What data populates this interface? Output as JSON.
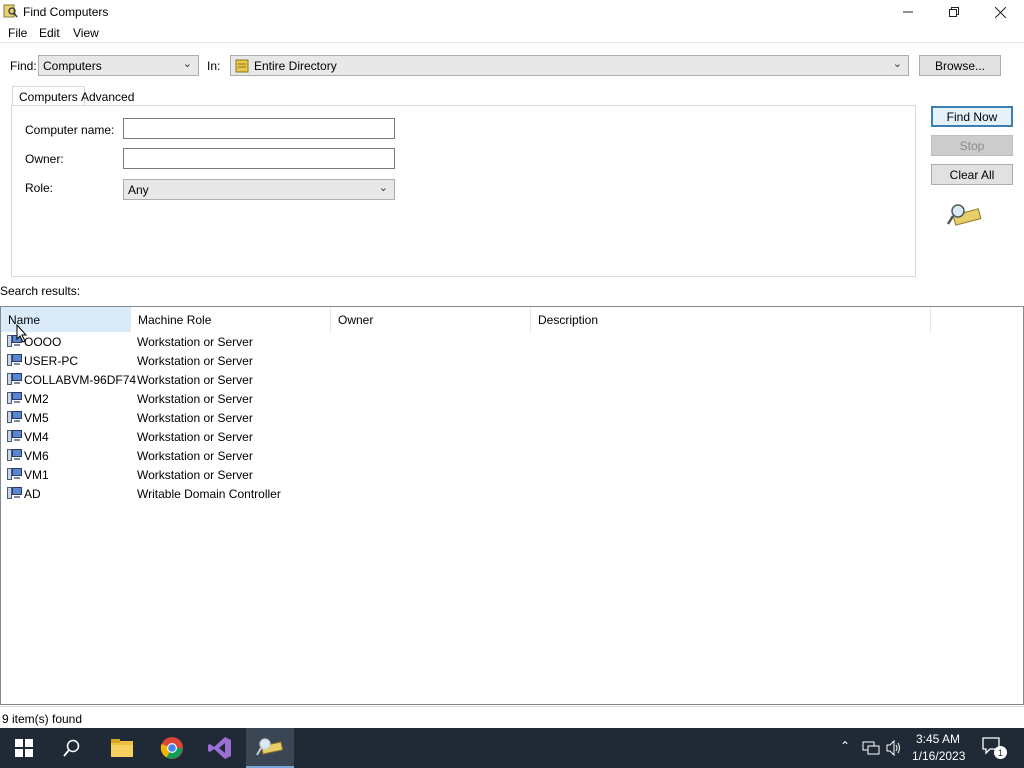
{
  "window": {
    "title": "Find Computers",
    "icon": "find-computers-icon"
  },
  "menu": [
    "File",
    "Edit",
    "View"
  ],
  "find_row": {
    "find_label": "Find:",
    "find_value": "Computers",
    "in_label": "In:",
    "in_value": "Entire Directory",
    "browse_label": "Browse..."
  },
  "tabs": [
    "Computers",
    "Advanced"
  ],
  "form": {
    "computer_name_label": "Computer name:",
    "computer_name_value": "",
    "owner_label": "Owner:",
    "owner_value": "",
    "role_label": "Role:",
    "role_value": "Any"
  },
  "actions": {
    "find_now": "Find Now",
    "stop": "Stop",
    "clear_all": "Clear All"
  },
  "results": {
    "label": "Search results:",
    "columns": [
      "Name",
      "Machine Role",
      "Owner",
      "Description"
    ],
    "rows": [
      {
        "name": "OOOO",
        "role": "Workstation or Server"
      },
      {
        "name": "USER-PC",
        "role": "Workstation or Server"
      },
      {
        "name": "COLLABVM-96DF74",
        "role": "Workstation or Server"
      },
      {
        "name": "VM2",
        "role": "Workstation or Server"
      },
      {
        "name": "VM5",
        "role": "Workstation or Server"
      },
      {
        "name": "VM4",
        "role": "Workstation or Server"
      },
      {
        "name": "VM6",
        "role": "Workstation or Server"
      },
      {
        "name": "VM1",
        "role": "Workstation or Server"
      },
      {
        "name": "AD",
        "role": "Writable Domain Controller"
      }
    ]
  },
  "status": "9 item(s) found",
  "taskbar": {
    "time": "3:45 AM",
    "date": "1/16/2023",
    "notification_count": "1"
  },
  "colors": {
    "taskbar": "#1f2a36",
    "accent": "#3c7fb1"
  }
}
